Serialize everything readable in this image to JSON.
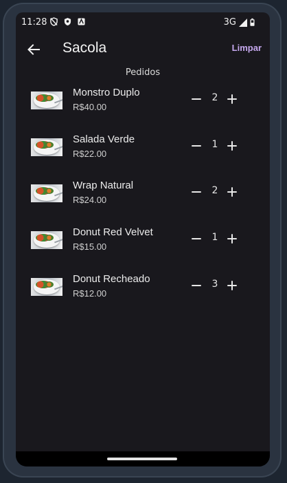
{
  "status_bar": {
    "time": "11:28",
    "network": "3G",
    "left_icons": [
      "shield-off-icon",
      "vpn-shield-icon",
      "android-auto-icon"
    ],
    "right_icons": [
      "signal-icon",
      "battery-icon"
    ]
  },
  "app_bar": {
    "title": "Sacola",
    "clear_label": "Limpar",
    "back_icon": "arrow-left-icon"
  },
  "section_title": "Pedidos",
  "items": [
    {
      "name": "Monstro Duplo",
      "price": "R$40.00",
      "quantity": "2"
    },
    {
      "name": "Salada Verde",
      "price": "R$22.00",
      "quantity": "1"
    },
    {
      "name": "Wrap Natural",
      "price": "R$24.00",
      "quantity": "2"
    },
    {
      "name": "Donut Red Velvet",
      "price": "R$15.00",
      "quantity": "1"
    },
    {
      "name": "Donut Recheado",
      "price": "R$12.00",
      "quantity": "3"
    }
  ],
  "colors": {
    "background": "#19181d",
    "accent": "#c5a8ee",
    "text": "#ececec"
  }
}
